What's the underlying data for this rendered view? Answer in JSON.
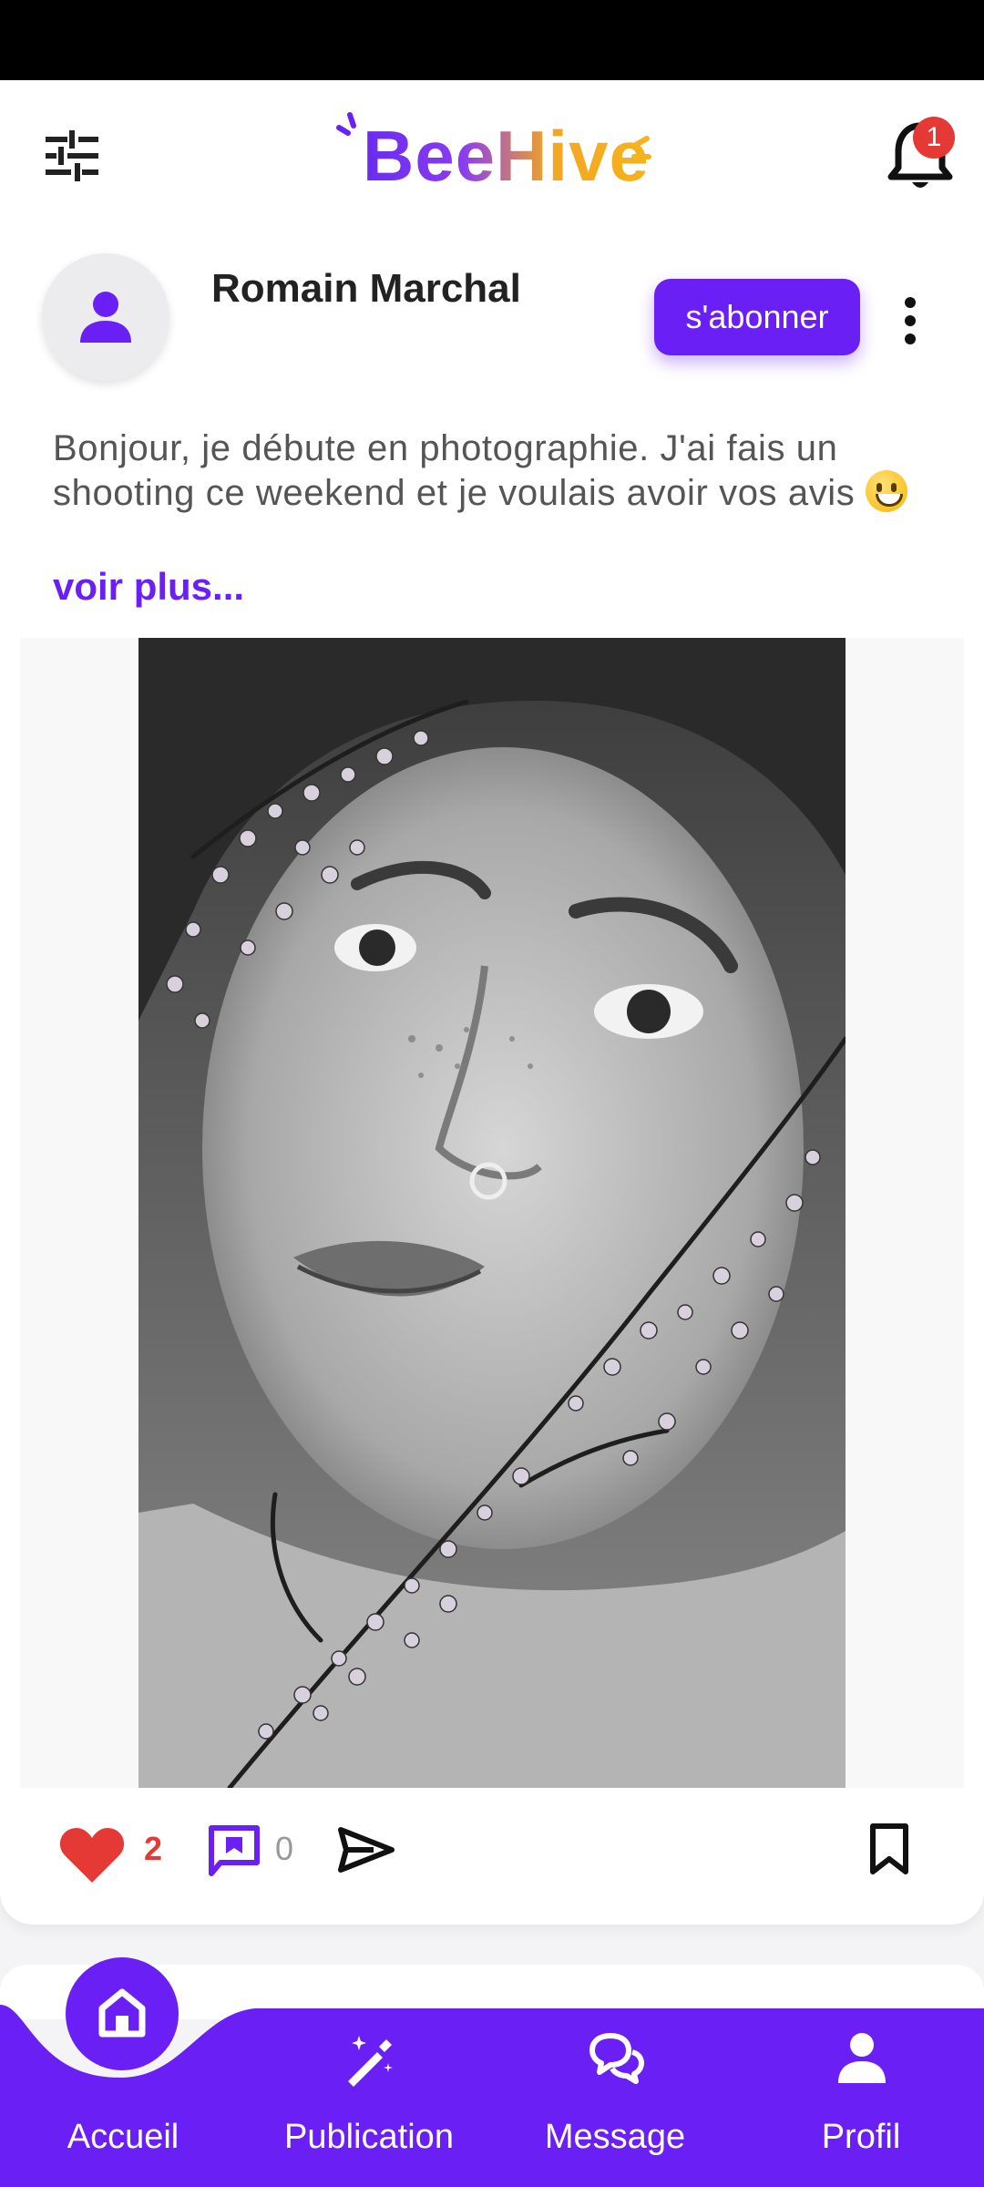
{
  "app": {
    "name": "BeeHive",
    "notifications_count": "1"
  },
  "post": {
    "author": "Romain Marchal",
    "subscribe_label": "s'abonner",
    "caption": "Bonjour, je débute en photographie. J'ai fais un shooting ce weekend et je voulais avoir vos avis",
    "see_more": "voir plus...",
    "likes": "2",
    "comments": "0"
  },
  "nav": {
    "items": [
      {
        "label": "Accueil",
        "icon": "home-icon",
        "active": true
      },
      {
        "label": "Publication",
        "icon": "magic-wand-icon"
      },
      {
        "label": "Message",
        "icon": "chat-icon"
      },
      {
        "label": "Profil",
        "icon": "person-icon"
      }
    ]
  },
  "colors": {
    "accent": "#6a1ff5",
    "like": "#e53935",
    "logo_orange": "#f5b31d"
  }
}
